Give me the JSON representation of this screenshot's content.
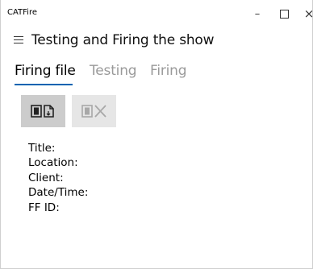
{
  "window": {
    "app_title": "CATFire",
    "minimize_glyph": "–",
    "close_glyph": "×"
  },
  "header": {
    "menu_icon": "hamburger-icon",
    "title": "Testing and Firing the show"
  },
  "tabs": [
    {
      "label": "Firing file",
      "active": true
    },
    {
      "label": "Testing",
      "active": false
    },
    {
      "label": "Firing",
      "active": false
    }
  ],
  "toolbar": {
    "load_icon": "open-file-icon",
    "clear_icon": "clear-file-icon",
    "accent_color": "#0063b1"
  },
  "info": {
    "title_label": "Title:",
    "location_label": "Location:",
    "client_label": "Client:",
    "datetime_label": "Date/Time:",
    "ffid_label": "FF ID:"
  }
}
